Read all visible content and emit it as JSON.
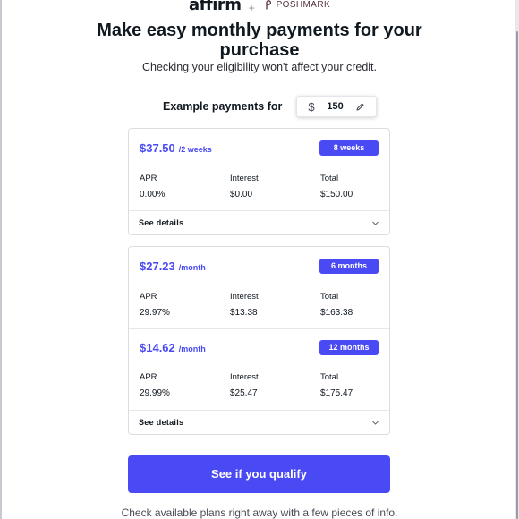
{
  "header": {
    "affirm_logo": "affirm",
    "plus": "+",
    "partner_logo": "POSHMARK"
  },
  "title": "Make easy monthly payments for your purchase",
  "subtitle": "Checking your eligibility won't affect your credit.",
  "example": {
    "label": "Example payments for",
    "currency_symbol": "$",
    "amount": "150"
  },
  "plans": [
    {
      "price": "$37.50",
      "period": "/2 weeks",
      "term": "8 weeks",
      "apr_label": "APR",
      "apr": "0.00%",
      "interest_label": "Interest",
      "interest": "$0.00",
      "total_label": "Total",
      "total": "$150.00"
    },
    {
      "price": "$27.23",
      "period": "/month",
      "term": "6 months",
      "apr_label": "APR",
      "apr": "29.97%",
      "interest_label": "Interest",
      "interest": "$13.38",
      "total_label": "Total",
      "total": "$163.38"
    },
    {
      "price": "$14.62",
      "period": "/month",
      "term": "12 months",
      "apr_label": "APR",
      "apr": "29.99%",
      "interest_label": "Interest",
      "interest": "$25.47",
      "total_label": "Total",
      "total": "$175.47"
    }
  ],
  "see_details_label": "See details",
  "cta": {
    "label": "See if you qualify"
  },
  "footer": "Check available plans right away with a few pieces of info.",
  "colors": {
    "accent": "#4a4af4",
    "text": "#101820"
  },
  "icons": [
    "pencil-icon",
    "chevron-down-icon",
    "poshmark-logo-icon"
  ]
}
